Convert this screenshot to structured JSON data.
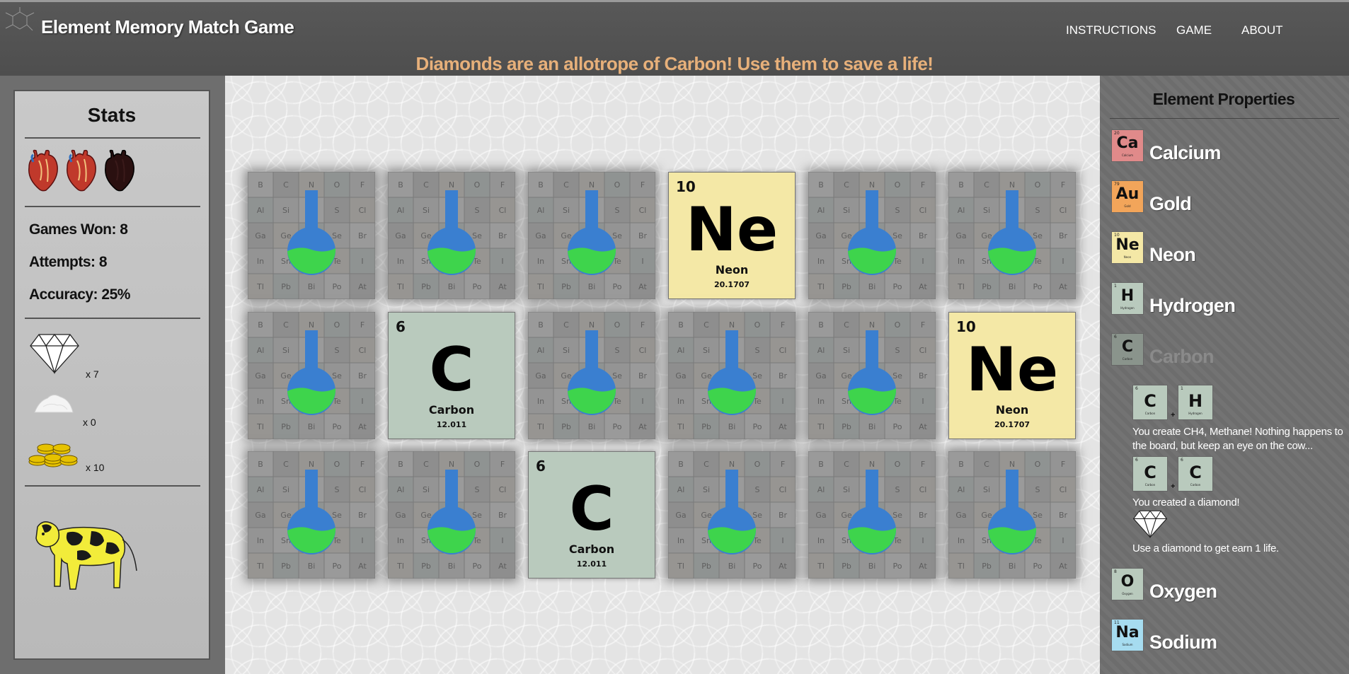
{
  "header": {
    "title": "Element Memory Match Game",
    "nav": [
      "INSTRUCTIONS",
      "GAME",
      "ABOUT"
    ],
    "banner": "Diamonds are an allotrope of Carbon! Use them to save a life!"
  },
  "stats": {
    "title": "Stats",
    "lives_total": 3,
    "lives_remaining": 2,
    "games_won": "Games Won: 8",
    "attempts": "Attempts: 8",
    "accuracy": "Accuracy: 25%",
    "inventory": [
      {
        "item": "diamond",
        "count": "x 7"
      },
      {
        "item": "salt",
        "count": "x 0"
      },
      {
        "item": "gold-coins",
        "count": "x 10"
      }
    ]
  },
  "board": {
    "cards": [
      {
        "state": "hidden"
      },
      {
        "state": "hidden"
      },
      {
        "state": "hidden"
      },
      {
        "state": "revealed",
        "element": "neon",
        "number": "10",
        "symbol": "Ne",
        "name": "Neon",
        "mass": "20.1707"
      },
      {
        "state": "hidden"
      },
      {
        "state": "hidden"
      },
      {
        "state": "hidden"
      },
      {
        "state": "revealed",
        "element": "carbon",
        "number": "6",
        "symbol": "C",
        "name": "Carbon",
        "mass": "12.011"
      },
      {
        "state": "hidden"
      },
      {
        "state": "hidden"
      },
      {
        "state": "hidden"
      },
      {
        "state": "revealed",
        "element": "neon",
        "number": "10",
        "symbol": "Ne",
        "name": "Neon",
        "mass": "20.1707"
      },
      {
        "state": "hidden"
      },
      {
        "state": "hidden"
      },
      {
        "state": "revealed",
        "element": "carbon",
        "number": "6",
        "symbol": "C",
        "name": "Carbon",
        "mass": "12.011"
      },
      {
        "state": "hidden"
      },
      {
        "state": "hidden"
      },
      {
        "state": "hidden"
      }
    ],
    "card_back_grid": [
      [
        "B",
        "C",
        "N",
        "O",
        "F"
      ],
      [
        "Al",
        "Si",
        "P",
        "S",
        "Cl"
      ],
      [
        "Ga",
        "Ge",
        "As",
        "Se",
        "Br"
      ],
      [
        "In",
        "Sn",
        "Sb",
        "Te",
        "I"
      ],
      [
        "Tl",
        "Pb",
        "Bi",
        "Po",
        "At"
      ]
    ]
  },
  "properties": {
    "title": "Element Properties",
    "elements": [
      {
        "num": "20",
        "symbol": "Ca",
        "tile_name": "Calcium",
        "name": "Calcium",
        "color": "#e08a8a",
        "dimmed": false
      },
      {
        "num": "79",
        "symbol": "Au",
        "tile_name": "Gold",
        "name": "Gold",
        "color": "#f2a55a",
        "dimmed": false
      },
      {
        "num": "10",
        "symbol": "Ne",
        "tile_name": "Neon",
        "name": "Neon",
        "color": "#f4e8a6",
        "dimmed": false
      },
      {
        "num": "1",
        "symbol": "H",
        "tile_name": "Hydrogen",
        "name": "Hydrogen",
        "color": "#b9cabd",
        "dimmed": false
      },
      {
        "num": "6",
        "symbol": "C",
        "tile_name": "Carbon",
        "name": "Carbon",
        "color": "#8a948c",
        "dimmed": true
      },
      {
        "num": "8",
        "symbol": "O",
        "tile_name": "Oxygen",
        "name": "Oxygen",
        "color": "#b9cabd",
        "dimmed": false
      },
      {
        "num": "11",
        "symbol": "Na",
        "tile_name": "Sodium",
        "name": "Sodium",
        "color": "#a6dcf0",
        "dimmed": false
      }
    ],
    "carbon_details": {
      "combo1": {
        "a_num": "6",
        "a_sym": "C",
        "a_name": "Carbon",
        "plus": "+",
        "b_num": "1",
        "b_sym": "H",
        "b_name": "Hydrogen"
      },
      "combo1_text": "You create CH4, Methane! Nothing happens to the board, but keep an eye on the cow...",
      "combo2": {
        "a_num": "6",
        "a_sym": "C",
        "a_name": "Carbon",
        "plus": "+",
        "b_num": "6",
        "b_sym": "C",
        "b_name": "Carbon"
      },
      "combo2_text": "You created a diamond!",
      "diamond_text": "Use a diamond to get earn 1 life."
    }
  }
}
